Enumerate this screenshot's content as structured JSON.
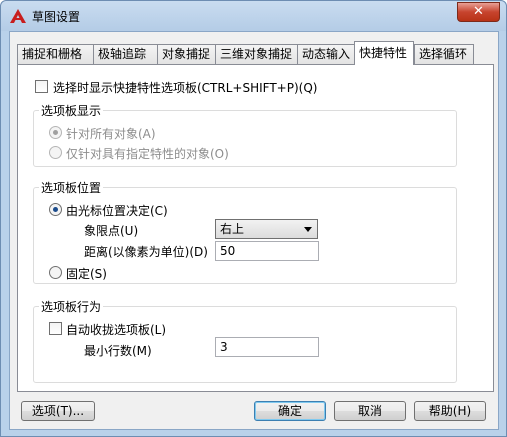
{
  "window": {
    "title": "草图设置"
  },
  "tabs": [
    {
      "label": "捕捉和栅格"
    },
    {
      "label": "极轴追踪"
    },
    {
      "label": "对象捕捉"
    },
    {
      "label": "三维对象捕捉"
    },
    {
      "label": "动态输入"
    },
    {
      "label": "快捷特性"
    },
    {
      "label": "选择循环"
    }
  ],
  "active_tab": "快捷特性",
  "show_on_select": {
    "label": "选择时显示快捷特性选项板(CTRL+SHIFT+P)(Q)",
    "checked": false
  },
  "palette_display": {
    "title": "选项板显示",
    "options": [
      {
        "label": "针对所有对象(A)",
        "selected": true
      },
      {
        "label": "仅针对具有指定特性的对象(O)",
        "selected": false
      }
    ]
  },
  "palette_location": {
    "title": "选项板位置",
    "cursor_option": {
      "label": "由光标位置决定(C)",
      "selected": true
    },
    "quadrant_label": "象限点(U)",
    "quadrant_value": "右上",
    "distance_label": "距离(以像素为单位)(D)",
    "distance_value": "50",
    "static_option": {
      "label": "固定(S)",
      "selected": false
    }
  },
  "palette_behavior": {
    "title": "选项板行为",
    "auto_collapse": {
      "label": "自动收拢选项板(L)",
      "checked": false
    },
    "min_rows_label": "最小行数(M)",
    "min_rows_value": "3"
  },
  "buttons": {
    "options": "选项(T)...",
    "ok": "确定",
    "cancel": "取消",
    "help": "帮助(H)"
  }
}
